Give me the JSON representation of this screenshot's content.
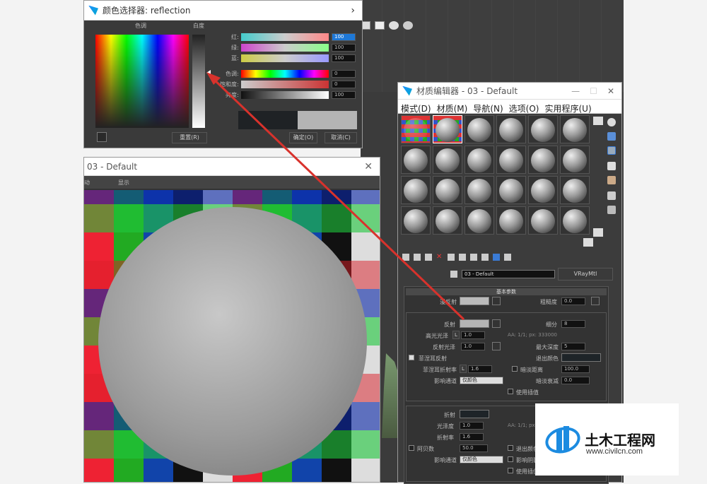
{
  "color_picker": {
    "title": "颜色选择器: reflection",
    "close": "›",
    "hue_label": "色调",
    "white_label": "白度",
    "rows": [
      {
        "label": "红:",
        "value": "100"
      },
      {
        "label": "绿:",
        "value": "100"
      },
      {
        "label": "蓝:",
        "value": "100"
      },
      {
        "label": "色调:",
        "value": "0"
      },
      {
        "label": "饱和度:",
        "value": "0"
      },
      {
        "label": "亮度:",
        "value": "100"
      }
    ],
    "reset": "重置(R)",
    "ok": "确定(O)",
    "cancel": "取消(C)"
  },
  "preview": {
    "title": "03 - Default",
    "menu_left": "动",
    "menu_mid": "显示"
  },
  "material_editor": {
    "title": "材质编辑器 - 03 - Default",
    "menu": [
      "模式(D)",
      "材质(M)",
      "导航(N)",
      "选项(O)",
      "实用程序(U)"
    ],
    "material_name": "03 - Default",
    "material_type": "VRayMtl",
    "rollout": "基本参数",
    "diffuse_label": "漫反射",
    "roughness_label": "粗糙度",
    "roughness_value": "0.0",
    "reflect_label": "反射",
    "subdivs_label": "细分",
    "subdivs_value": "8",
    "hilight_label": "高光光泽",
    "hilight_lock": "L",
    "hilight_value": "1.0",
    "aa_text": "AA: 1/1; px: 333000",
    "refl_gloss_label": "反射光泽",
    "refl_gloss_value": "1.0",
    "max_depth_label": "最大深度",
    "max_depth_value": "5",
    "fresnel_label": "菲涅耳反射",
    "exit_color_label": "退出颜色",
    "fresnel_ior_label": "菲涅耳折射率",
    "fresnel_ior_lock": "L",
    "fresnel_ior_value": "1.6",
    "dim_distance_label": "暗淡距离",
    "dim_distance_value": "100.0",
    "affect_channels_label": "影响通道",
    "affect_channels_value": "仅颜色",
    "dim_falloff_label": "暗淡衰减",
    "dim_falloff_value": "0.0",
    "use_interp_label": "使用插值",
    "refract_label": "折射",
    "gloss_label": "光泽度",
    "gloss_value": "1.0",
    "ior_label": "折射率",
    "ior_value": "1.6",
    "aa2_text": "AA: 1/1; px:",
    "abbe_label": "阿贝数",
    "abbe_value": "50.0",
    "exit_color2_label": "退出颜色",
    "affect_shadows_label": "影响阴影",
    "affect_channels2_label": "影响通道",
    "affect_channels2_value": "仅颜色",
    "use_interp2_label": "使用插值"
  },
  "watermark": {
    "name": "土木工程网",
    "url": "www.civilcn.com"
  },
  "colors": {
    "accent": "#1e78d7",
    "arrow": "#d8322c",
    "panel": "#3c3c3c"
  }
}
